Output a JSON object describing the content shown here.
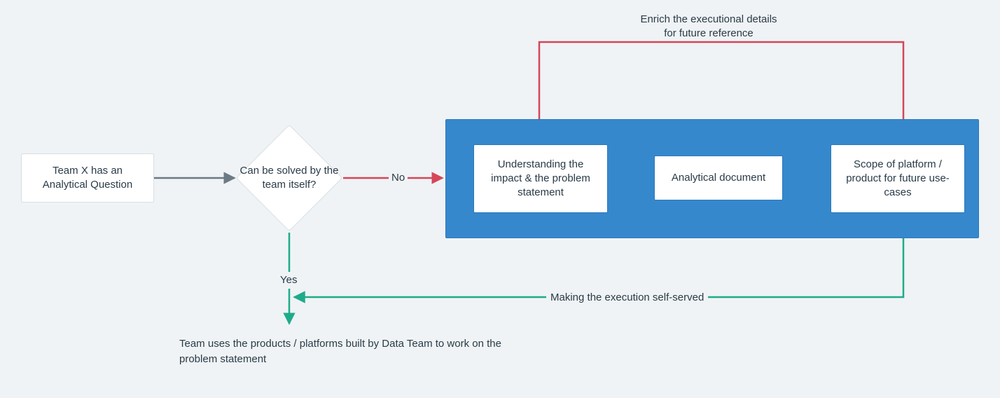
{
  "nodes": {
    "start": "Team X has an Analytical Question",
    "decision": "Can be solved by the team itself?",
    "understand": "Understanding the impact & the problem statement",
    "doc": "Analytical document",
    "scope": "Scope of platform / product for future use-cases"
  },
  "labels": {
    "no": "No",
    "yes": "Yes",
    "enrich_line1": "Enrich the executional details",
    "enrich_line2": "for future reference",
    "self_served": "Making the execution self-served"
  },
  "result_text": "Team uses the products / platforms built by Data Team to work on the problem statement",
  "colors": {
    "gray": "#6c7a83",
    "red": "#d64558",
    "green": "#1fab8a",
    "white": "#ffffff",
    "group_bg": "#3688cc",
    "group_border": "#2a79bf"
  }
}
